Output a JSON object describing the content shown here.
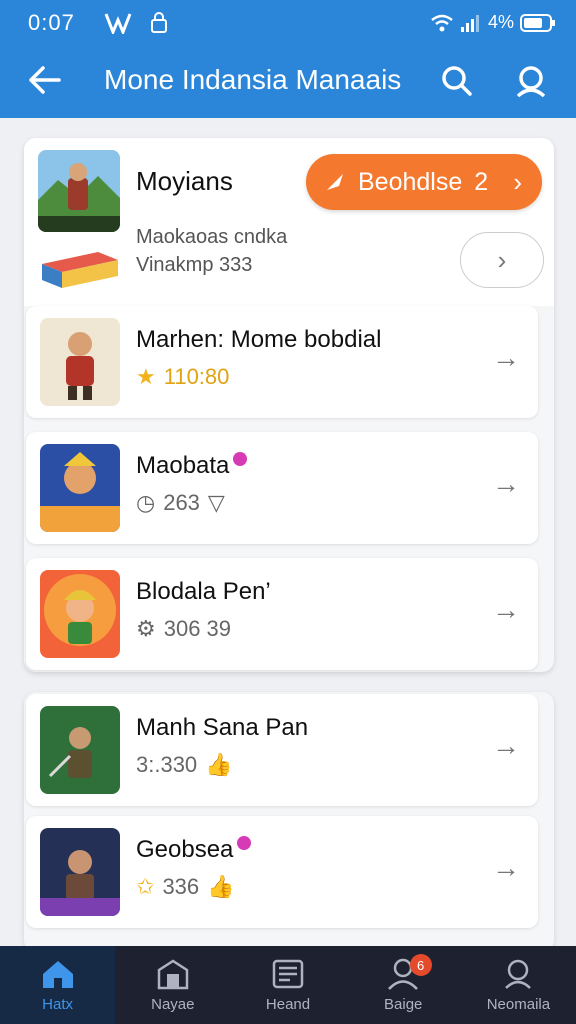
{
  "status": {
    "time": "0:07",
    "battery": "4%"
  },
  "header": {
    "title": "Mone Indansia Manaais"
  },
  "featured": {
    "title": "Moyians",
    "badge_label": "Beohdlse",
    "badge_count": "2",
    "subtitle_1": "Maokaoas cndka",
    "subtitle_2": "Vinakmp 333"
  },
  "list_items": [
    {
      "title": "Marhen: Mome bobdial",
      "meta": "110:80"
    },
    {
      "title": "Maobata",
      "meta": "263"
    },
    {
      "title": "Blodala Pen’",
      "meta": "306 39"
    },
    {
      "title": "Manh Sana Pan",
      "meta": "3:.330"
    },
    {
      "title": "Geobsea",
      "meta": "336"
    }
  ],
  "nav": [
    {
      "label": "Hatx",
      "icon": "home-icon"
    },
    {
      "label": "Nayae",
      "icon": "store-icon"
    },
    {
      "label": "Heand",
      "icon": "news-icon"
    },
    {
      "label": "Baige",
      "icon": "person-icon",
      "badge": "6"
    },
    {
      "label": "Neomaila",
      "icon": "profile-icon"
    }
  ],
  "colors": {
    "primary": "#2b86d9",
    "accent": "#f4792e",
    "nav_bg": "#1e2230"
  }
}
